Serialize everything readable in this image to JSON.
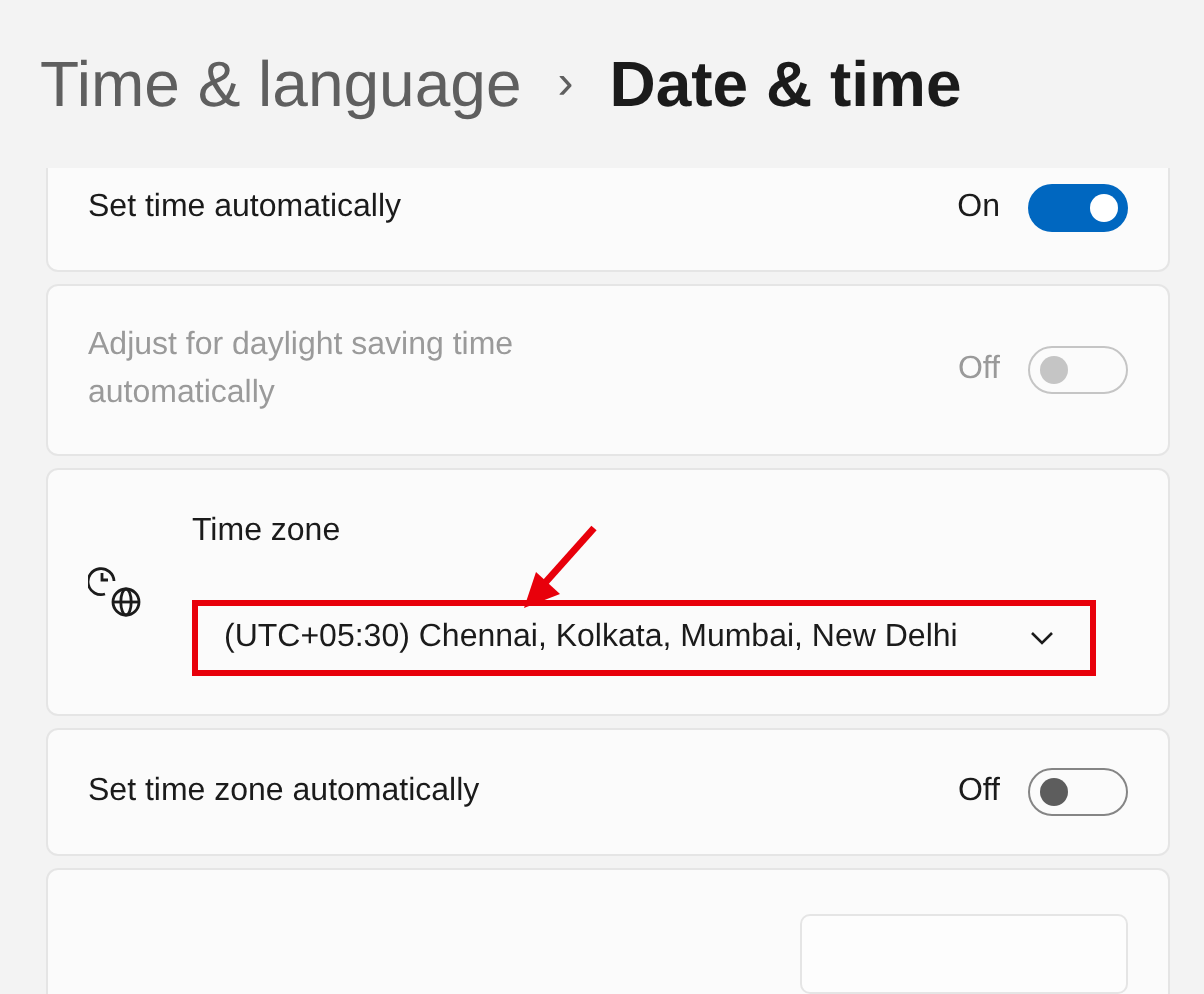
{
  "breadcrumb": {
    "parent": "Time & language",
    "separator": "›",
    "current": "Date & time"
  },
  "settings": [
    {
      "kind": "toggle",
      "label": "Set time automatically",
      "state_text": "On",
      "on": true,
      "disabled": false
    },
    {
      "kind": "toggle",
      "label": "Adjust for daylight saving time automatically",
      "state_text": "Off",
      "on": false,
      "disabled": true
    },
    {
      "kind": "select",
      "label": "Time zone",
      "value": "(UTC+05:30) Chennai, Kolkata, Mumbai, New Delhi",
      "highlighted": true
    },
    {
      "kind": "toggle",
      "label": "Set time zone automatically",
      "state_text": "Off",
      "on": false,
      "disabled": false
    },
    {
      "kind": "button_row"
    }
  ]
}
